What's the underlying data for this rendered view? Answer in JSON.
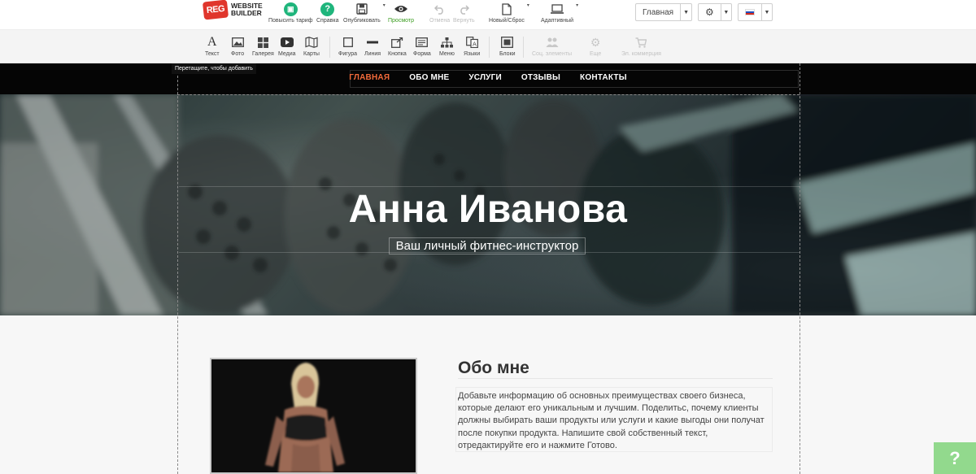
{
  "logo": {
    "badge": "REG",
    "line1": "WEBSITE",
    "line2": "BUILDER"
  },
  "toolbar": {
    "upgrade": "Повысить тариф",
    "help": "Справка",
    "publish": "Опубликовать",
    "preview": "Просмотр",
    "undo": "Отмена",
    "redo": "Вернуть",
    "new_reset": "Новый/Сброс",
    "adaptive": "Адаптивный",
    "page_select": "Главная",
    "help_glyph": "?"
  },
  "elements": {
    "text": "Текст",
    "photo": "Фото",
    "gallery": "Галерея",
    "media": "Медиа",
    "maps": "Карты",
    "shape": "Фигура",
    "line": "Линия",
    "button": "Кнопка",
    "form": "Форма",
    "menu": "Меню",
    "languages": "Языки",
    "blocks": "Блоки",
    "social": "Соц. элементы",
    "more": "Еще",
    "ecommerce": "Эл. коммерция"
  },
  "tooltip": "Перетащите, чтобы добавить",
  "site_nav": {
    "items": [
      "ГЛАВНАЯ",
      "ОБО МНЕ",
      "УСЛУГИ",
      "ОТЗЫВЫ",
      "КОНТАКТЫ"
    ],
    "active_color": "#f26a3a"
  },
  "hero": {
    "title": "Анна Иванова",
    "subtitle": "Ваш личный фитнес-инструктор"
  },
  "about": {
    "title": "Обо мне",
    "text": "Добавьте информацию об основных преимуществах своего бизнеса, которые делают его уникальным и лучшим. Поделитьс, почему клиенты должны выбирать ваши продукты или услуги и какие выгоды они получат после покупки продукта. Напишите свой собственный текст, отредактируйте его и нажмите Готово."
  },
  "help_widget": "?"
}
